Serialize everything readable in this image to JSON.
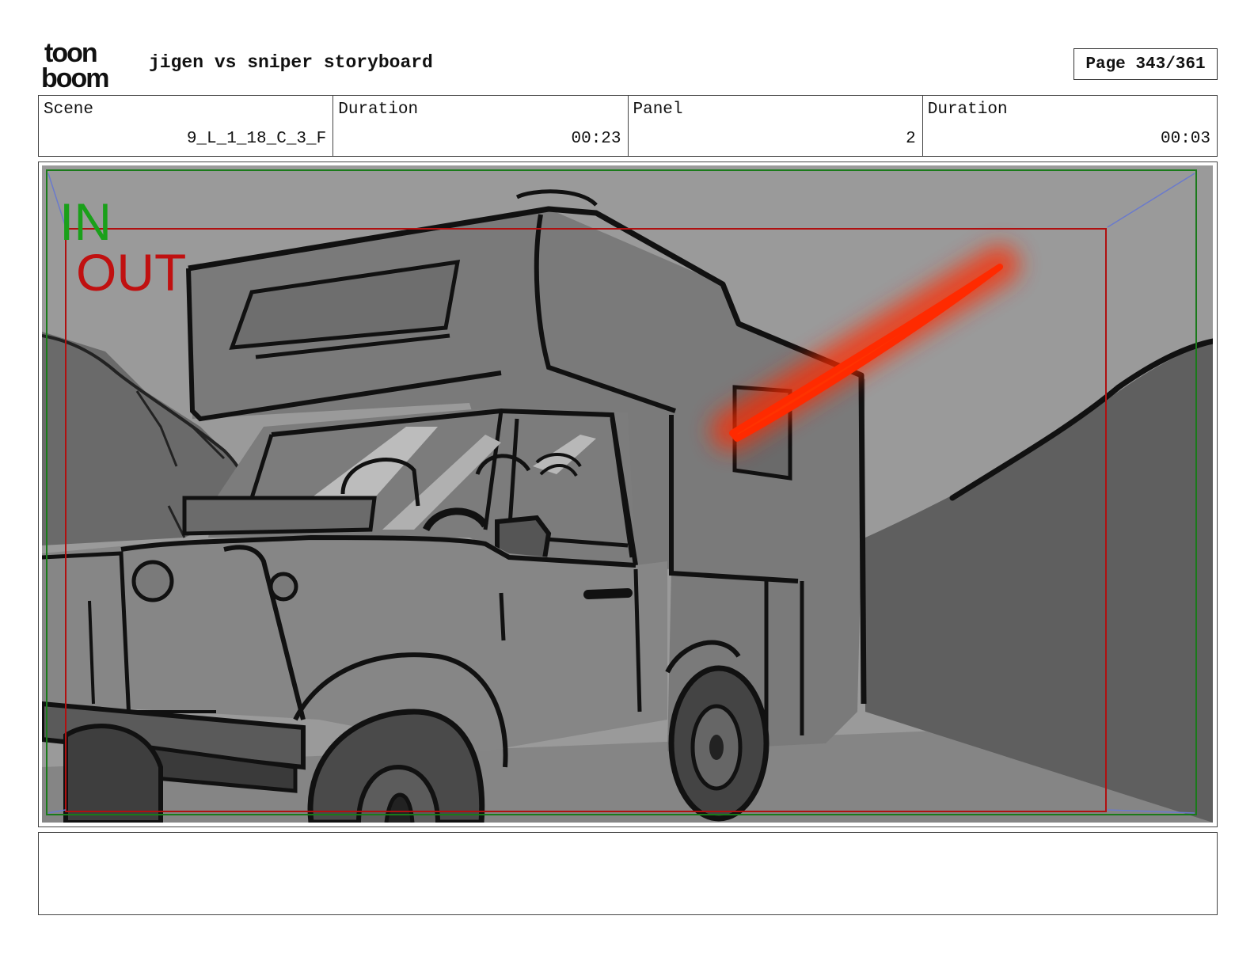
{
  "header": {
    "logo_text_top": "toon",
    "logo_text_bottom": "boom",
    "title": "jigen vs sniper storyboard",
    "page": "Page 343/361"
  },
  "info": {
    "scene_label": "Scene",
    "scene_value": "9_L_1_18_C_3_F",
    "scene_duration_label": "Duration",
    "scene_duration_value": "00:23",
    "panel_label": "Panel",
    "panel_value": "2",
    "panel_duration_label": "Duration",
    "panel_duration_value": "00:03"
  },
  "panel": {
    "in_label": "IN",
    "out_label": "OUT",
    "in_color": "#1aa01a",
    "out_color": "#c01010",
    "laser_color": "#ff2a00"
  },
  "notes": {
    "text": ""
  }
}
